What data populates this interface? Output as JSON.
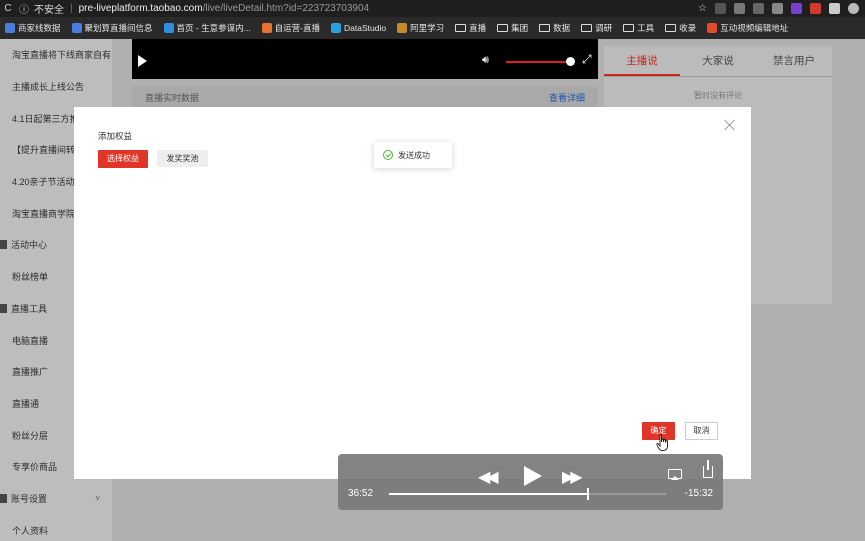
{
  "browser": {
    "security_label": "不安全",
    "url_host": "pre-liveplatform.taobao.com",
    "url_path": "/live/liveDetail.htm?id=223723703904"
  },
  "bookmarks": [
    {
      "label": "商家线数据",
      "icon": "doc-icon",
      "color": "#4a7de0"
    },
    {
      "label": "聚划算直播间信息",
      "icon": "doc-icon",
      "color": "#4a7de0"
    },
    {
      "label": "首页 - 生意参谋内...",
      "icon": "globe-icon",
      "color": "#2f8de4"
    },
    {
      "label": "自运营-直播",
      "icon": "clock-icon",
      "color": "#e8712e"
    },
    {
      "label": "DataStudio",
      "icon": "x-icon",
      "color": "#2a9fd8"
    },
    {
      "label": "阿里学习",
      "icon": "owl-icon",
      "color": "#c48b2a"
    },
    {
      "label": "直播",
      "icon": "folder-icon",
      "color": ""
    },
    {
      "label": "集团",
      "icon": "folder-icon",
      "color": ""
    },
    {
      "label": "数据",
      "icon": "folder-icon",
      "color": ""
    },
    {
      "label": "调研",
      "icon": "folder-icon",
      "color": ""
    },
    {
      "label": "工具",
      "icon": "folder-icon",
      "color": ""
    },
    {
      "label": "收录",
      "icon": "folder-icon",
      "color": ""
    },
    {
      "label": "互动视频编辑地址",
      "icon": "tag-icon",
      "color": "#e14a2a"
    }
  ],
  "sidebar": {
    "items": [
      {
        "label": "淘宝直播将下线商家自有",
        "type": "item"
      },
      {
        "label": "主播成长上线公告",
        "type": "item"
      },
      {
        "label": "4.1日起第三方推",
        "type": "item"
      },
      {
        "label": "【提升直播间转",
        "type": "item"
      },
      {
        "label": "4.20亲子节活动",
        "type": "item"
      },
      {
        "label": "淘宝直播商学院",
        "type": "item"
      },
      {
        "label": "活动中心",
        "type": "group"
      },
      {
        "label": "粉丝榜单",
        "type": "item"
      },
      {
        "label": "直播工具",
        "type": "group"
      },
      {
        "label": "电脑直播",
        "type": "item"
      },
      {
        "label": "直播推广",
        "type": "item"
      },
      {
        "label": "直播通",
        "type": "item"
      },
      {
        "label": "粉丝分层",
        "type": "item"
      },
      {
        "label": "专享价商品",
        "type": "item"
      },
      {
        "label": "账号设置",
        "type": "group"
      },
      {
        "label": "个人资料",
        "type": "item"
      }
    ]
  },
  "live_data": {
    "label": "直播实时数据",
    "more": "查看详细"
  },
  "chat": {
    "tabs": [
      "主播说",
      "大家说",
      "禁言用户"
    ],
    "active_tab": 0,
    "empty_text": "暂时没有评论"
  },
  "modal": {
    "title": "添加权益",
    "select_label": "选择权益",
    "pool_label": "发奖奖池",
    "toast": "发送成功",
    "confirm_label": "确定",
    "cancel_label": "取消"
  },
  "media": {
    "elapsed": "36:52",
    "remaining": "-15:32",
    "progress": 0.72
  },
  "colors": {
    "accent": "#e2352a",
    "link": "#1d55a7",
    "success": "#52b52e"
  }
}
